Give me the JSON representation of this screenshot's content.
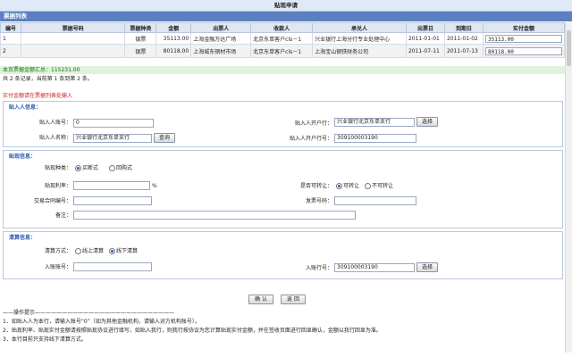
{
  "window": {
    "title": "贴现申请"
  },
  "bill_list": {
    "header": "票据列表",
    "columns": [
      "编号",
      "票据号码",
      "票据种类",
      "金额",
      "出票人",
      "收款人",
      "承兑人",
      "出票日",
      "到期日",
      "实付金额"
    ],
    "rows": [
      {
        "no": "1",
        "bill_no": "",
        "type": "银票",
        "amount": "35113.00",
        "drawer": "上海金融万达广场",
        "payee": "北京东单客户cls－1",
        "acceptor": "兴业银行上海分行专业处理中心",
        "issue_date": "2011-01-01",
        "due_date": "2011-01-02",
        "paid": "35113.00"
      },
      {
        "no": "2",
        "bill_no": "",
        "type": "银票",
        "amount": "80118.00",
        "drawer": "上海城东钢材市场",
        "payee": "北京东单客户cls－1",
        "acceptor": "上海宝山钢铁财务公司",
        "issue_date": "2011-07-11",
        "due_date": "2011-07-13",
        "paid": "80118.00"
      }
    ],
    "summary": "本页票据金额汇总：115231.00",
    "pager": "共 2 条记录，当前第 1 条到第 2 条。"
  },
  "note": "实付金额请在票据列表处输入",
  "discount_person": {
    "title": "贴入人信息：",
    "account_label": "贴入人账号：",
    "account_value": "0",
    "name_label": "贴入人名称：",
    "name_value": "兴业银行北京东单支行",
    "bank_label": "贴入人开户行：",
    "bank_value": "兴业银行北京东单支行",
    "bankno_label": "贴入人开户行号：",
    "bankno_value": "309100003190",
    "select_label": "选择",
    "query_label": "查询"
  },
  "discount_info": {
    "title": "贴现信息：",
    "type_label": "贴现种类：",
    "type_opt1": "买断式",
    "type_opt2": "回购式",
    "rate_label": "贴现利率：",
    "rate_value": "",
    "rate_unit": "%",
    "transfer_label": "是否可转让：",
    "transfer_opt1": "可转让",
    "transfer_opt2": "不可转让",
    "contract_label": "交易合同编号：",
    "contract_value": "",
    "invoice_label": "发票号码：",
    "invoice_value": "",
    "remark_label": "备注：",
    "remark_value": ""
  },
  "settle_info": {
    "title": "清算信息：",
    "mode_label": "清算方式：",
    "mode_opt1": "线上清算",
    "mode_opt2": "线下清算",
    "account_label": "入账账号：",
    "account_value": "",
    "bankno_label": "入账行号：",
    "bankno_value": "309100003190",
    "select_label": "选择"
  },
  "actions": {
    "confirm": "确 认",
    "back": "返 回"
  },
  "tips": {
    "header": "——操作提示——————————————————————————",
    "line1": "1．如贴入人为本行，请输入账号“0”（如为其他金融机构，请输入对方机构账号）。",
    "line2": "2．贴现利率、贴现实付金额请按照贴现协议进行填写，如贴入我行，则我行按协议为您计算贴现实付金额，并在签收页面进行回显确认，金额以我行回显为准。",
    "line3": "3．本行目前只支持线下清算方式。"
  }
}
